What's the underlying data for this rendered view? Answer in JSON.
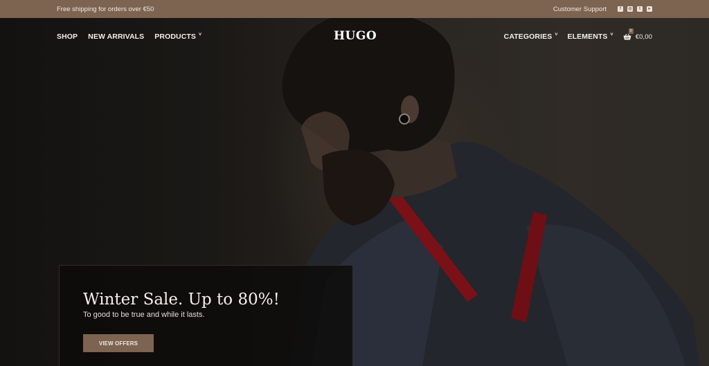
{
  "topbar": {
    "shipping_text": "Free shipping for orders over €50",
    "support_label": "Customer Support",
    "social": [
      {
        "icon": "facebook-icon",
        "glyph": "f"
      },
      {
        "icon": "instagram-icon",
        "glyph": "◎"
      },
      {
        "icon": "twitter-icon",
        "glyph": "t"
      },
      {
        "icon": "youtube-icon",
        "glyph": "▸"
      }
    ]
  },
  "header": {
    "logo": "HUGO",
    "nav_left": [
      {
        "label": "SHOP",
        "has_dropdown": false
      },
      {
        "label": "NEW ARRIVALS",
        "has_dropdown": false
      },
      {
        "label": "PRODUCTS",
        "has_dropdown": true
      }
    ],
    "nav_right": [
      {
        "label": "CATEGORIES",
        "has_dropdown": true
      },
      {
        "label": "ELEMENTS",
        "has_dropdown": true
      }
    ],
    "cart": {
      "count": "0",
      "total": "€0,00"
    },
    "caret_glyph": "˅"
  },
  "hero": {
    "title": "Winter Sale. Up to 80%!",
    "subtitle": "To good to be true and while it lasts.",
    "cta_label": "VIEW OFFERS"
  },
  "colors": {
    "brand": "#7c6450",
    "background": "#1a1816"
  }
}
